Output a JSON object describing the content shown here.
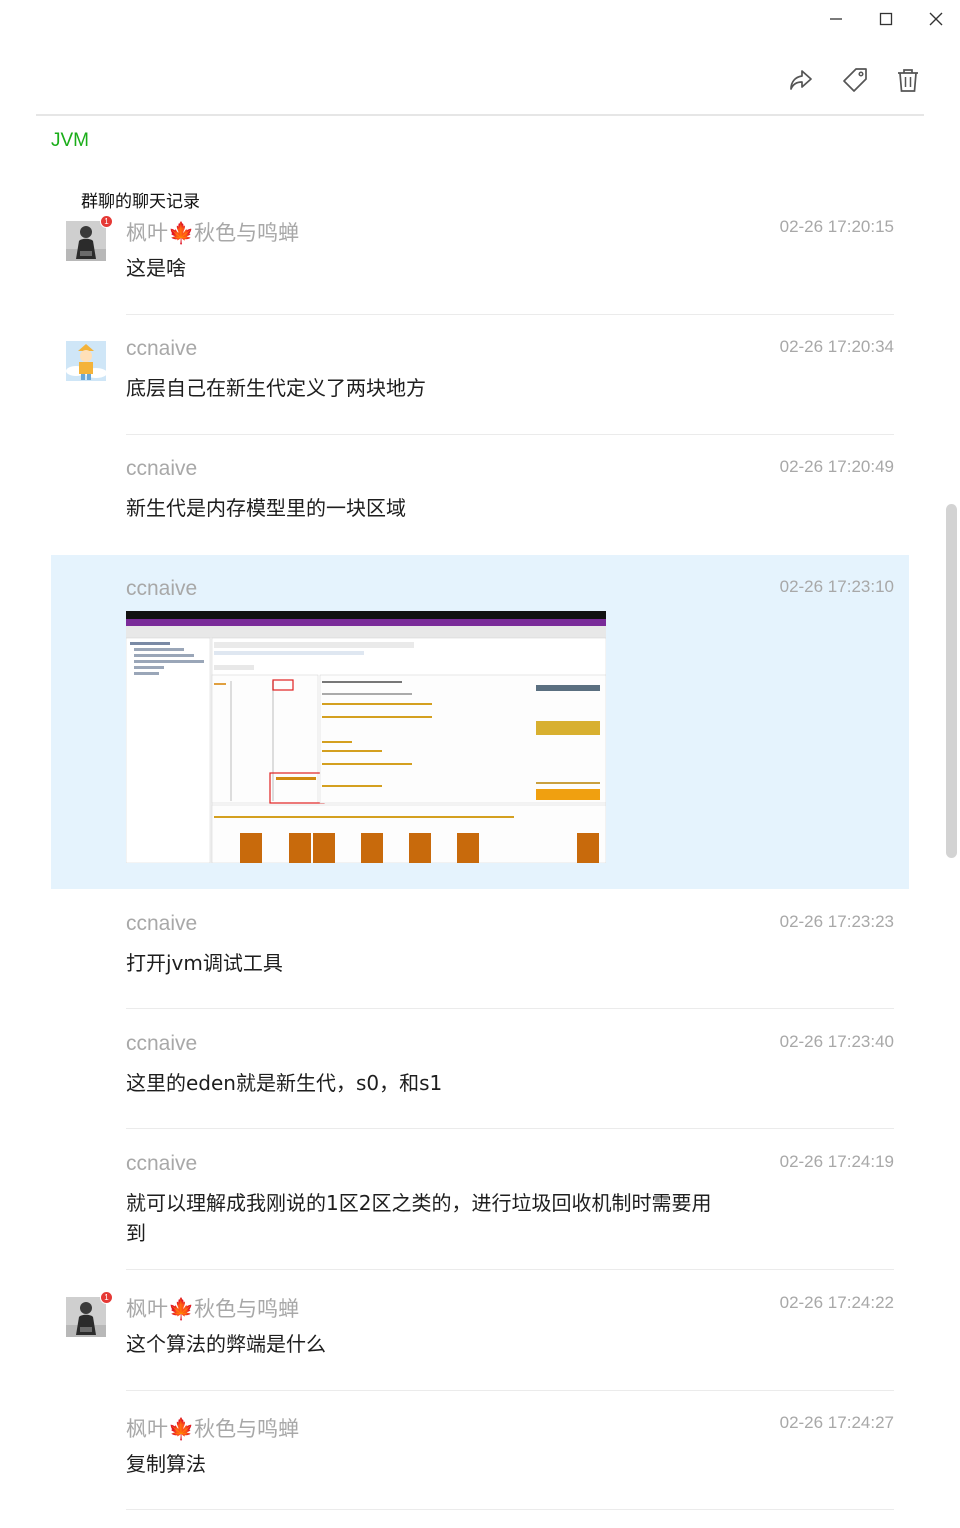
{
  "window": {
    "controls": [
      "minimize-icon",
      "maximize-icon",
      "close-icon"
    ]
  },
  "toolbar": {
    "icons": [
      "share-icon",
      "tag-icon",
      "delete-icon"
    ]
  },
  "note": {
    "tag": "JVM",
    "title": "群聊的聊天记录"
  },
  "messages": [
    {
      "sender": "枫叶🍁秋色与鸣蝉",
      "time": "02-26 17:20:15",
      "text": "这是啥",
      "avatar": "person-avatar",
      "badge": "1"
    },
    {
      "sender": "ccnaive",
      "time": "02-26 17:20:34",
      "text": "底层自己在新生代定义了两块地方",
      "avatar": "cartoon-avatar"
    },
    {
      "sender": "ccnaive",
      "time": "02-26 17:20:49",
      "text": "新生代是内存模型里的一块区域"
    },
    {
      "sender": "ccnaive",
      "time": "02-26 17:23:10",
      "image": "jvm-visualgc-screenshot"
    },
    {
      "sender": "ccnaive",
      "time": "02-26 17:23:23",
      "text": "打开jvm调试工具"
    },
    {
      "sender": "ccnaive",
      "time": "02-26 17:23:40",
      "text": "这里的eden就是新生代，s0，和s1"
    },
    {
      "sender": "ccnaive",
      "time": "02-26 17:24:19",
      "text": "就可以理解成我刚说的1区2区之类的，进行垃圾回收机制时需要用到"
    },
    {
      "sender": "枫叶🍁秋色与鸣蝉",
      "time": "02-26 17:24:22",
      "text": "这个算法的弊端是什么",
      "avatar": "person-avatar",
      "badge": "1"
    },
    {
      "sender": "枫叶🍁秋色与鸣蝉",
      "time": "02-26 17:24:27",
      "text": "复制算法"
    }
  ],
  "colors": {
    "tag": "#1aad19",
    "selected_bg": "#e5f3fd",
    "meta_text": "#a8a8a8",
    "badge": "#e53935"
  }
}
